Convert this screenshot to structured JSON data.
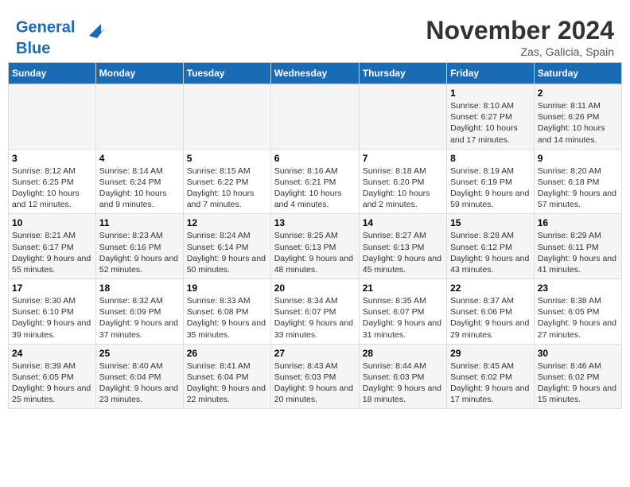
{
  "header": {
    "logo_line1": "General",
    "logo_line2": "Blue",
    "month_title": "November 2024",
    "location": "Zas, Galicia, Spain"
  },
  "days_of_week": [
    "Sunday",
    "Monday",
    "Tuesday",
    "Wednesday",
    "Thursday",
    "Friday",
    "Saturday"
  ],
  "weeks": [
    [
      {
        "day": "",
        "info": ""
      },
      {
        "day": "",
        "info": ""
      },
      {
        "day": "",
        "info": ""
      },
      {
        "day": "",
        "info": ""
      },
      {
        "day": "",
        "info": ""
      },
      {
        "day": "1",
        "info": "Sunrise: 8:10 AM\nSunset: 6:27 PM\nDaylight: 10 hours and 17 minutes."
      },
      {
        "day": "2",
        "info": "Sunrise: 8:11 AM\nSunset: 6:26 PM\nDaylight: 10 hours and 14 minutes."
      }
    ],
    [
      {
        "day": "3",
        "info": "Sunrise: 8:12 AM\nSunset: 6:25 PM\nDaylight: 10 hours and 12 minutes."
      },
      {
        "day": "4",
        "info": "Sunrise: 8:14 AM\nSunset: 6:24 PM\nDaylight: 10 hours and 9 minutes."
      },
      {
        "day": "5",
        "info": "Sunrise: 8:15 AM\nSunset: 6:22 PM\nDaylight: 10 hours and 7 minutes."
      },
      {
        "day": "6",
        "info": "Sunrise: 8:16 AM\nSunset: 6:21 PM\nDaylight: 10 hours and 4 minutes."
      },
      {
        "day": "7",
        "info": "Sunrise: 8:18 AM\nSunset: 6:20 PM\nDaylight: 10 hours and 2 minutes."
      },
      {
        "day": "8",
        "info": "Sunrise: 8:19 AM\nSunset: 6:19 PM\nDaylight: 9 hours and 59 minutes."
      },
      {
        "day": "9",
        "info": "Sunrise: 8:20 AM\nSunset: 6:18 PM\nDaylight: 9 hours and 57 minutes."
      }
    ],
    [
      {
        "day": "10",
        "info": "Sunrise: 8:21 AM\nSunset: 6:17 PM\nDaylight: 9 hours and 55 minutes."
      },
      {
        "day": "11",
        "info": "Sunrise: 8:23 AM\nSunset: 6:16 PM\nDaylight: 9 hours and 52 minutes."
      },
      {
        "day": "12",
        "info": "Sunrise: 8:24 AM\nSunset: 6:14 PM\nDaylight: 9 hours and 50 minutes."
      },
      {
        "day": "13",
        "info": "Sunrise: 8:25 AM\nSunset: 6:13 PM\nDaylight: 9 hours and 48 minutes."
      },
      {
        "day": "14",
        "info": "Sunrise: 8:27 AM\nSunset: 6:13 PM\nDaylight: 9 hours and 45 minutes."
      },
      {
        "day": "15",
        "info": "Sunrise: 8:28 AM\nSunset: 6:12 PM\nDaylight: 9 hours and 43 minutes."
      },
      {
        "day": "16",
        "info": "Sunrise: 8:29 AM\nSunset: 6:11 PM\nDaylight: 9 hours and 41 minutes."
      }
    ],
    [
      {
        "day": "17",
        "info": "Sunrise: 8:30 AM\nSunset: 6:10 PM\nDaylight: 9 hours and 39 minutes."
      },
      {
        "day": "18",
        "info": "Sunrise: 8:32 AM\nSunset: 6:09 PM\nDaylight: 9 hours and 37 minutes."
      },
      {
        "day": "19",
        "info": "Sunrise: 8:33 AM\nSunset: 6:08 PM\nDaylight: 9 hours and 35 minutes."
      },
      {
        "day": "20",
        "info": "Sunrise: 8:34 AM\nSunset: 6:07 PM\nDaylight: 9 hours and 33 minutes."
      },
      {
        "day": "21",
        "info": "Sunrise: 8:35 AM\nSunset: 6:07 PM\nDaylight: 9 hours and 31 minutes."
      },
      {
        "day": "22",
        "info": "Sunrise: 8:37 AM\nSunset: 6:06 PM\nDaylight: 9 hours and 29 minutes."
      },
      {
        "day": "23",
        "info": "Sunrise: 8:38 AM\nSunset: 6:05 PM\nDaylight: 9 hours and 27 minutes."
      }
    ],
    [
      {
        "day": "24",
        "info": "Sunrise: 8:39 AM\nSunset: 6:05 PM\nDaylight: 9 hours and 25 minutes."
      },
      {
        "day": "25",
        "info": "Sunrise: 8:40 AM\nSunset: 6:04 PM\nDaylight: 9 hours and 23 minutes."
      },
      {
        "day": "26",
        "info": "Sunrise: 8:41 AM\nSunset: 6:04 PM\nDaylight: 9 hours and 22 minutes."
      },
      {
        "day": "27",
        "info": "Sunrise: 8:43 AM\nSunset: 6:03 PM\nDaylight: 9 hours and 20 minutes."
      },
      {
        "day": "28",
        "info": "Sunrise: 8:44 AM\nSunset: 6:03 PM\nDaylight: 9 hours and 18 minutes."
      },
      {
        "day": "29",
        "info": "Sunrise: 8:45 AM\nSunset: 6:02 PM\nDaylight: 9 hours and 17 minutes."
      },
      {
        "day": "30",
        "info": "Sunrise: 8:46 AM\nSunset: 6:02 PM\nDaylight: 9 hours and 15 minutes."
      }
    ]
  ]
}
